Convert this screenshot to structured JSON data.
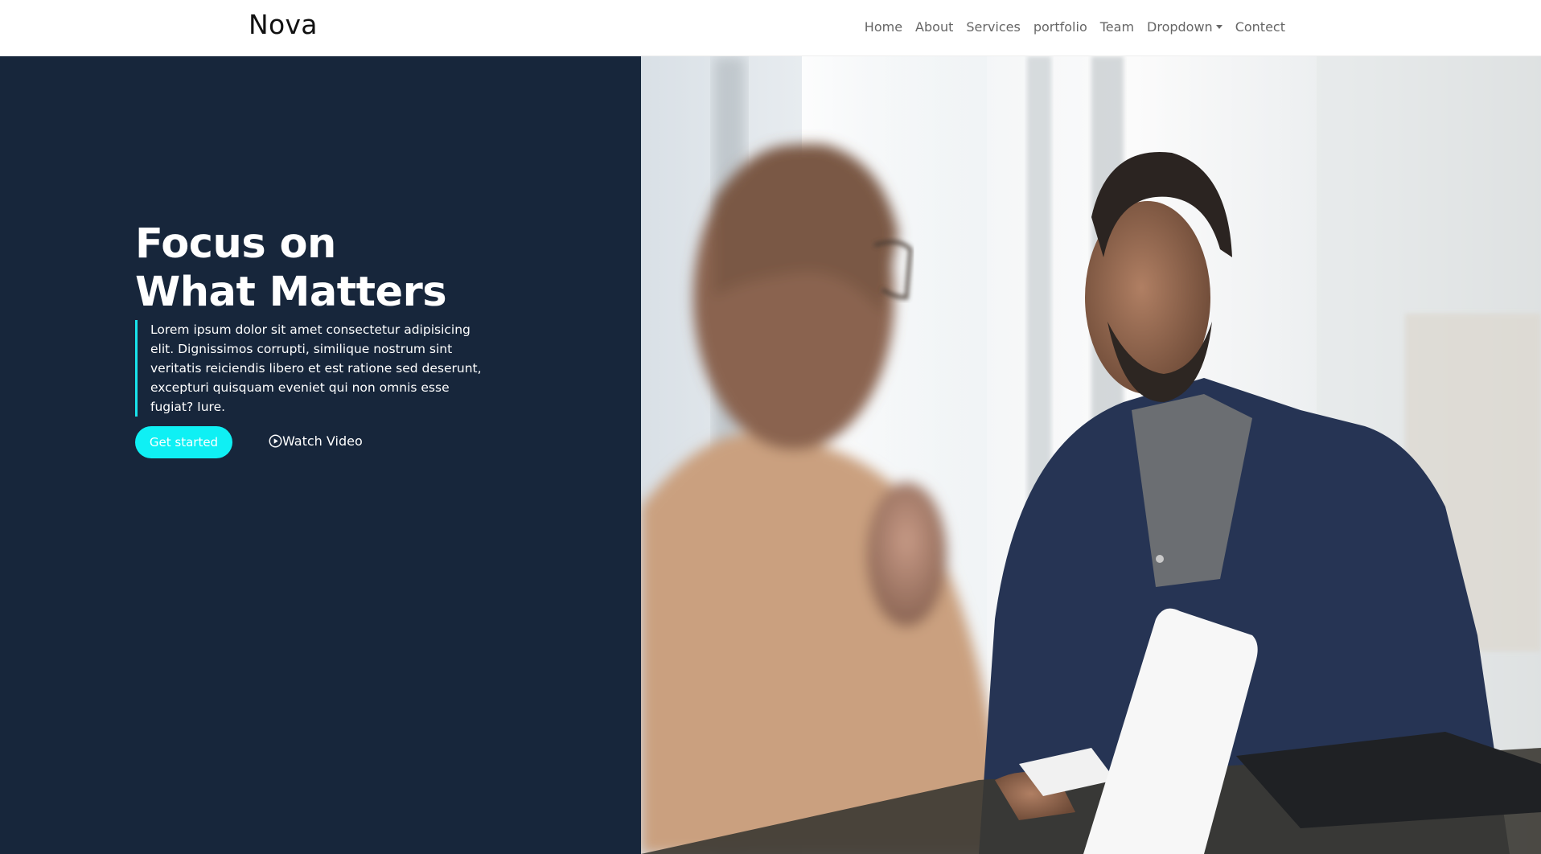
{
  "nav": {
    "brand": "Nova",
    "links": [
      "Home",
      "About",
      "Services",
      "portfolio",
      "Team",
      "Dropdown",
      "Contect"
    ]
  },
  "hero": {
    "title_line1": "Focus on",
    "title_line2": "What Matters",
    "description": "Lorem ipsum dolor sit amet consectetur adipisicing elit. Dignissimos corrupti, similique nostrum sint veritatis reiciendis libero et est ratione sed deserunt, excepturi quisquam eveniet qui non omnis esse fugiat? Iure.",
    "cta_label": "Get started",
    "video_label": "Watch Video"
  },
  "colors": {
    "hero_bg": "#17263b",
    "accent": "#0ff0f4",
    "nav_text": "#666666"
  },
  "icons": {
    "video": "play-circle-icon",
    "dropdown": "caret-down-icon"
  }
}
